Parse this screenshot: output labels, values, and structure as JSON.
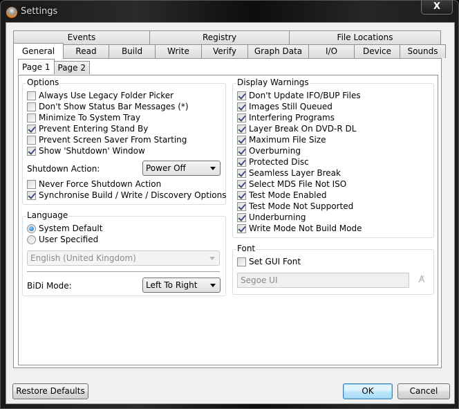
{
  "window": {
    "title": "Settings",
    "app_icon": "disc-app-icon",
    "close_label": "X"
  },
  "tabs": {
    "back_row": [
      {
        "label": "Events"
      },
      {
        "label": "Registry"
      },
      {
        "label": "File Locations"
      }
    ],
    "front_row": [
      {
        "label": "General",
        "active": true
      },
      {
        "label": "Read"
      },
      {
        "label": "Build"
      },
      {
        "label": "Write"
      },
      {
        "label": "Verify"
      },
      {
        "label": "Graph Data"
      },
      {
        "label": "I/O"
      },
      {
        "label": "Device"
      },
      {
        "label": "Sounds"
      }
    ]
  },
  "subtabs": [
    {
      "label": "Page 1",
      "active": true
    },
    {
      "label": "Page 2"
    }
  ],
  "options": {
    "title": "Options",
    "items": [
      {
        "label": "Always Use Legacy Folder Picker",
        "checked": false
      },
      {
        "label": "Don't Show Status Bar Messages (*)",
        "checked": false
      },
      {
        "label": "Minimize To System Tray",
        "checked": false
      },
      {
        "label": "Prevent Entering Stand By",
        "checked": true
      },
      {
        "label": "Prevent Screen Saver From Starting",
        "checked": false
      },
      {
        "label": "Show 'Shutdown' Window",
        "checked": true
      }
    ],
    "shutdown_action_label": "Shutdown Action:",
    "shutdown_action_value": "Power Off",
    "extra_items": [
      {
        "label": "Never Force Shutdown Action",
        "checked": false
      },
      {
        "label": "Synchronise Build / Write / Discovery Options",
        "checked": true
      }
    ]
  },
  "language": {
    "title": "Language",
    "radios": [
      {
        "label": "System Default",
        "selected": true
      },
      {
        "label": "User Specified",
        "selected": false
      }
    ],
    "language_value": "English (United Kingdom)",
    "bidi_label": "BiDi Mode:",
    "bidi_value": "Left To Right"
  },
  "display_warnings": {
    "title": "Display Warnings",
    "items": [
      {
        "label": "Don't Update IFO/BUP Files",
        "checked": true
      },
      {
        "label": "Images Still Queued",
        "checked": true
      },
      {
        "label": "Interfering Programs",
        "checked": true
      },
      {
        "label": "Layer Break On DVD-R DL",
        "checked": true
      },
      {
        "label": "Maximum File Size",
        "checked": true
      },
      {
        "label": "Overburning",
        "checked": true
      },
      {
        "label": "Protected Disc",
        "checked": true
      },
      {
        "label": "Seamless Layer Break",
        "checked": true
      },
      {
        "label": "Select MDS File Not ISO",
        "checked": true
      },
      {
        "label": "Test Mode Enabled",
        "checked": true
      },
      {
        "label": "Test Mode Not Supported",
        "checked": true
      },
      {
        "label": "Underburning",
        "checked": true
      },
      {
        "label": "Write Mode Not Build Mode",
        "checked": true
      }
    ]
  },
  "font": {
    "title": "Font",
    "set_gui_font_label": "Set GUI Font",
    "set_gui_font_checked": false,
    "font_value": "Segoe UI",
    "font_button_icon": "font-picker-icon"
  },
  "footer": {
    "restore_label": "Restore Defaults",
    "ok_label": "OK",
    "cancel_label": "Cancel"
  }
}
